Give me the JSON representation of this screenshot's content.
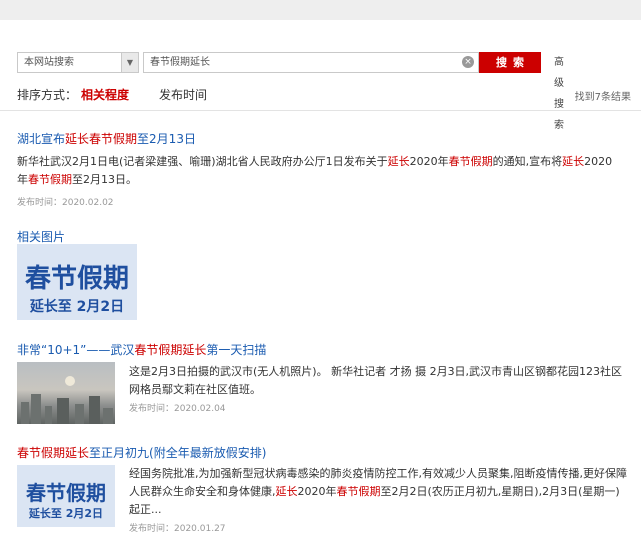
{
  "search": {
    "scope": "本网站搜索",
    "query": "春节假期延长",
    "button": "搜索",
    "advanced": "高级搜索"
  },
  "sort": {
    "label": "排序方式：",
    "relevance": "相关程度",
    "time": "发布时间",
    "count": "找到7条结果"
  },
  "result1": {
    "title": [
      "湖北宣布",
      "延长",
      "春节假期",
      "至2月13日"
    ],
    "snippet": [
      "新华社武汉2月1日电(记者梁建强、喻珊)湖北省人民政府办公厅1日发布关于",
      "延长",
      "2020年",
      "春节假期",
      "的通知,宣布将",
      "延长",
      "2020年",
      "春节假期",
      "至2月13日。"
    ],
    "date": "发布时间：2020.02.02"
  },
  "related_pics": {
    "label": "相关图片",
    "banner_title": "春节假期",
    "banner_sub": "延长至 2月2日"
  },
  "result3": {
    "title": [
      "非常“10+1”——武汉",
      "春节假期延长",
      "第一天扫描"
    ],
    "snippet": "这是2月3日拍摄的武汉市(无人机照片)。 新华社记者 才扬 摄 2月3日,武汉市青山区钢都花园123社区网格员鄢文莉在社区值班。",
    "date": "发布时间：2020.02.04"
  },
  "result4": {
    "title": [
      "春节假期延长",
      "至正月初九(附全年最新放假安排)"
    ],
    "snippet": [
      "经国务院批准,为加强新型冠状病毒感染的肺炎疫情防控工作,有效减少人员聚集,阻断疫情传播,更好保障人民群众生命安全和身体健康,",
      "延长",
      "2020年",
      "春节假期",
      "至2月2日(农历正月初九,星期日),2月3日(星期一)起正..."
    ],
    "date": "发布时间：2020.01.27",
    "banner_title": "春节假期",
    "banner_sub": "延长至 2月2日"
  },
  "colors": {
    "accent": "#cc0000",
    "link": "#1a5bb0",
    "banner": "#1f4f9f"
  }
}
